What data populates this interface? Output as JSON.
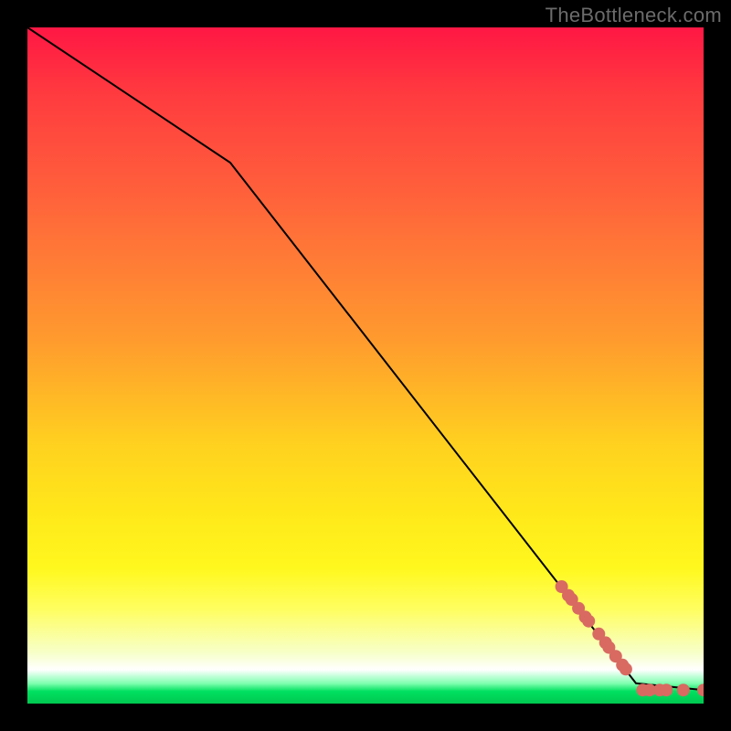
{
  "watermark": "TheBottleneck.com",
  "colors": {
    "background": "#000000",
    "line": "#000000",
    "marker": "#d86a62",
    "gradient_stops": [
      "#ff1744",
      "#ff3b3f",
      "#ff5a3c",
      "#ff7a36",
      "#ff9a2e",
      "#ffd21f",
      "#ffe81a",
      "#fff81e",
      "#fffe60",
      "#f7ffc9",
      "#ffffff",
      "#80ffb0",
      "#00e060",
      "#00c850"
    ]
  },
  "chart_data": {
    "type": "line",
    "title": "",
    "xlabel": "",
    "ylabel": "",
    "xlim": [
      0,
      100
    ],
    "ylim": [
      0,
      100
    ],
    "grid": false,
    "legend": false,
    "series": [
      {
        "name": "curve",
        "style": "line",
        "x": [
          0,
          30,
          90,
          100
        ],
        "y": [
          100,
          80,
          3,
          2
        ]
      },
      {
        "name": "points-on-line",
        "style": "scatter",
        "x": [
          79,
          80,
          80.5,
          81.5,
          82.5,
          83,
          84.5,
          85.5,
          86,
          87,
          88,
          88.5
        ],
        "y": [
          17.3,
          16.0,
          15.4,
          14.1,
          12.8,
          12.2,
          10.3,
          9.0,
          8.3,
          7.0,
          5.7,
          5.1
        ]
      },
      {
        "name": "points-bottom",
        "style": "scatter",
        "x": [
          91,
          92,
          93.5,
          94.5,
          97,
          100
        ],
        "y": [
          2,
          2,
          2,
          2,
          2,
          2
        ]
      }
    ]
  }
}
